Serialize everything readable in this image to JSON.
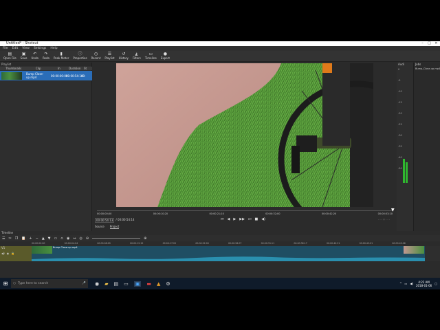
{
  "window": {
    "title": "Untitled* - Shotcut"
  },
  "menu": [
    "File",
    "Edit",
    "View",
    "Settings",
    "Help"
  ],
  "toolbar": [
    {
      "label": "Open File",
      "icon": "folder-open-icon",
      "glyph": "▤"
    },
    {
      "label": "Save",
      "icon": "save-icon",
      "glyph": "▣"
    },
    {
      "label": "Undo",
      "icon": "undo-icon",
      "glyph": "↶"
    },
    {
      "label": "Redo",
      "icon": "redo-icon",
      "glyph": "↷"
    },
    {
      "label": "Peak Meter",
      "icon": "peak-meter-icon",
      "glyph": "▮"
    },
    {
      "label": "Properties",
      "icon": "properties-icon",
      "glyph": "ⓘ"
    },
    {
      "label": "Recent",
      "icon": "recent-icon",
      "glyph": "◷"
    },
    {
      "label": "Playlist",
      "icon": "playlist-icon",
      "glyph": "☰"
    },
    {
      "label": "History",
      "icon": "history-icon",
      "glyph": "↺"
    },
    {
      "label": "Filters",
      "icon": "filters-icon",
      "glyph": "◭"
    },
    {
      "label": "Timeline",
      "icon": "timeline-icon",
      "glyph": "▭"
    },
    {
      "label": "Export",
      "icon": "export-icon",
      "glyph": "●"
    }
  ],
  "playlist": {
    "title": "Playlist",
    "columns": [
      "Thumbnails",
      "Clip",
      "In",
      "Duration",
      "St"
    ],
    "row": {
      "clip": "Bump Close-up.mp4",
      "in": "00:00:00:00",
      "duration": "00:00:54:14",
      "start": "00:"
    },
    "tabs": [
      "Properties",
      "Playlist",
      "Filters",
      "Export"
    ]
  },
  "viewer": {
    "ruler": [
      "00:00:00;00",
      "00:00:10;20",
      "00:00:21;10",
      "00:00:32;00",
      "00:00:42;20",
      "00:00:53;10"
    ],
    "current": "00:00:54:13",
    "total": "/ 00:00:54:14",
    "tabs": [
      "Source",
      "Project"
    ]
  },
  "audio": {
    "title": "Audi",
    "scale": [
      "0",
      "-5",
      "-10",
      "-15",
      "-20",
      "-25",
      "-30",
      "-35",
      "-40",
      "-50"
    ]
  },
  "jobs": {
    "title": "Jobs",
    "item": "Bump_Close-up.mp4 done",
    "pause": "Pause"
  },
  "timeline": {
    "title": "Timeline",
    "track": "V1",
    "clip": "Bump Close-up.mp4",
    "ticks": [
      "00:00:00:00",
      "00:00:04:04",
      "00:00:08:09",
      "00:00:12:15",
      "00:00:17:20",
      "00:00:22:00",
      "00:00:26:07",
      "00:00:31:11",
      "00:00:36:17",
      "00:00:40:21",
      "00:00:45:01",
      "00:00:49:06"
    ]
  },
  "taskbar": {
    "search": "Type here to search",
    "time": "4:22 AM",
    "date": "2018-01-06"
  },
  "colors": {
    "selection": "#2a6db8",
    "audioMeter": "#2fb82f",
    "waveform": "#1f6e8a",
    "clip": "#1f4e63"
  }
}
